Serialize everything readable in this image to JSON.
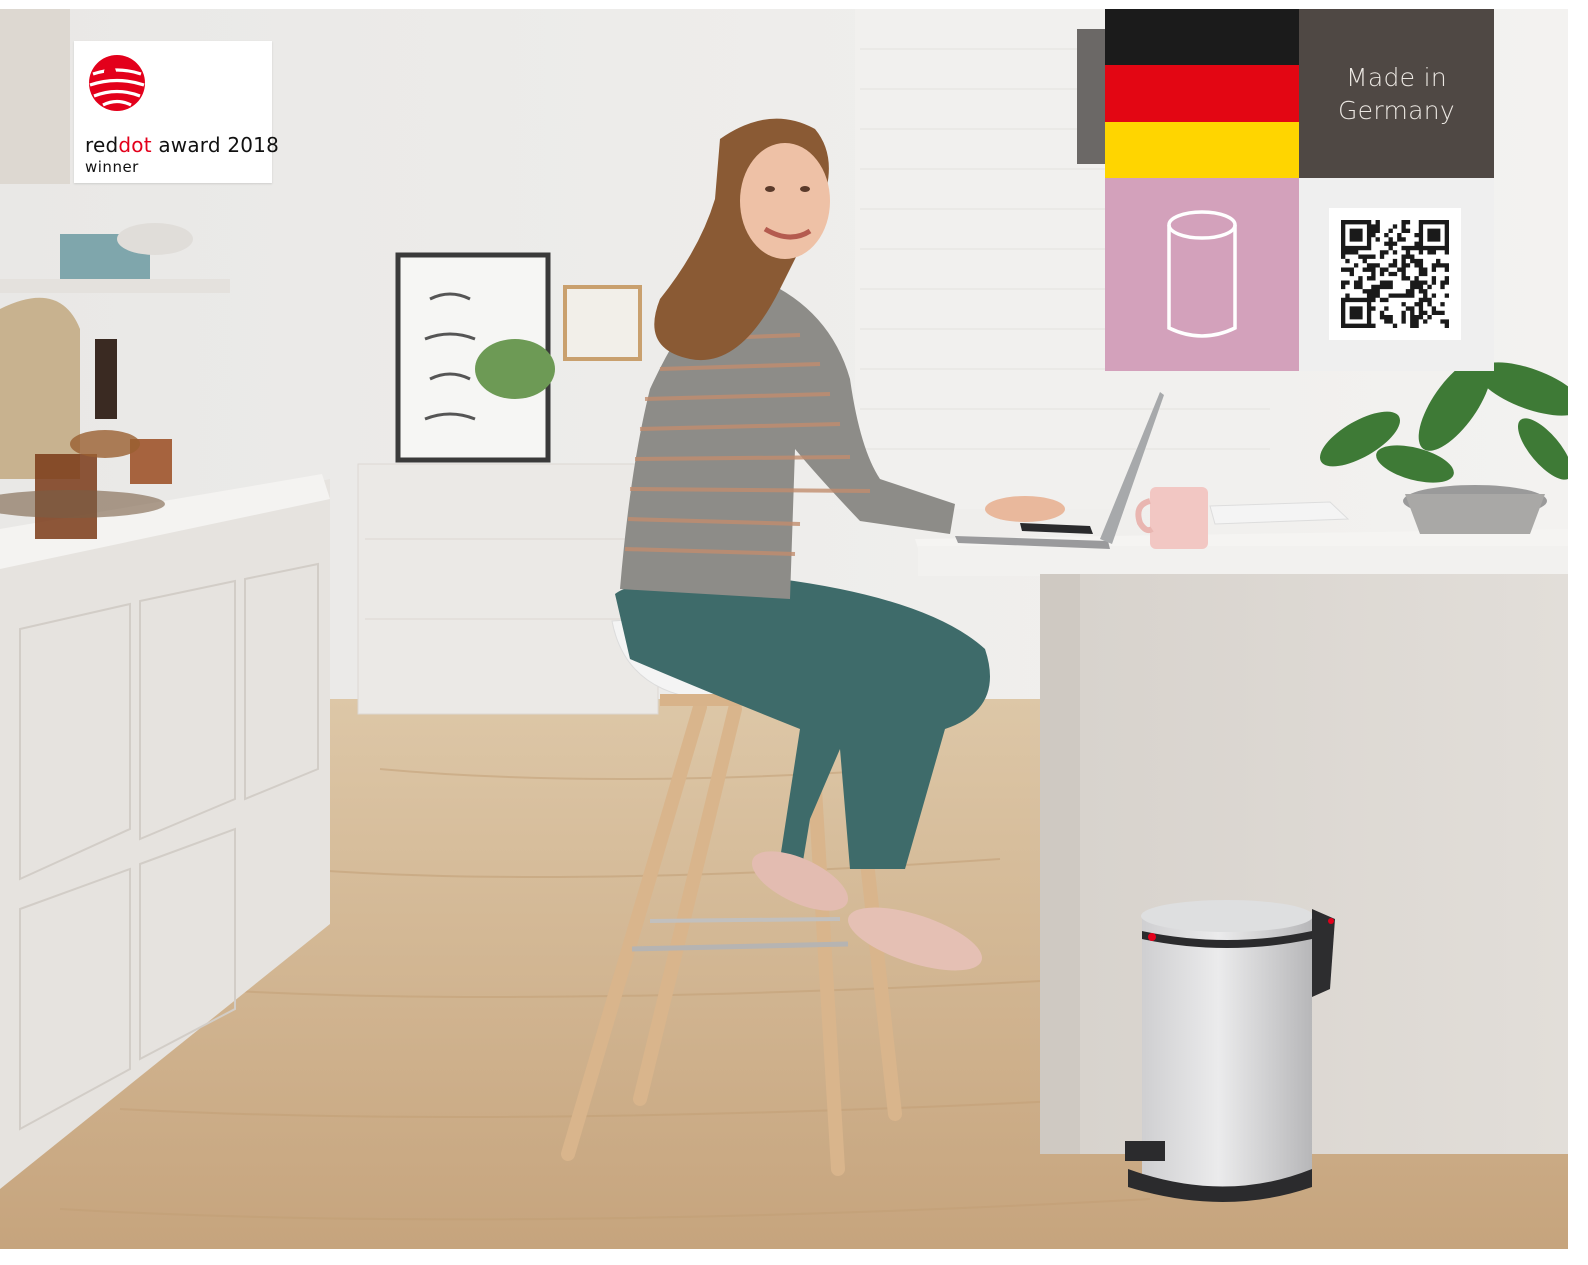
{
  "badge": {
    "line1_prefix": "red",
    "line1_highlight": "dot",
    "line1_suffix": " award 2018",
    "line2": "winner",
    "accent": "#e3001b"
  },
  "info": {
    "flag_colors": [
      "#1b1b1b",
      "#e30613",
      "#ffd500"
    ],
    "made_in": "Made in Germany",
    "made_in_bg": "#4f4844",
    "can_tile_bg": "#d3a1bb",
    "can_icon": "cylinder-icon",
    "qr_icon": "qr-code-icon"
  }
}
